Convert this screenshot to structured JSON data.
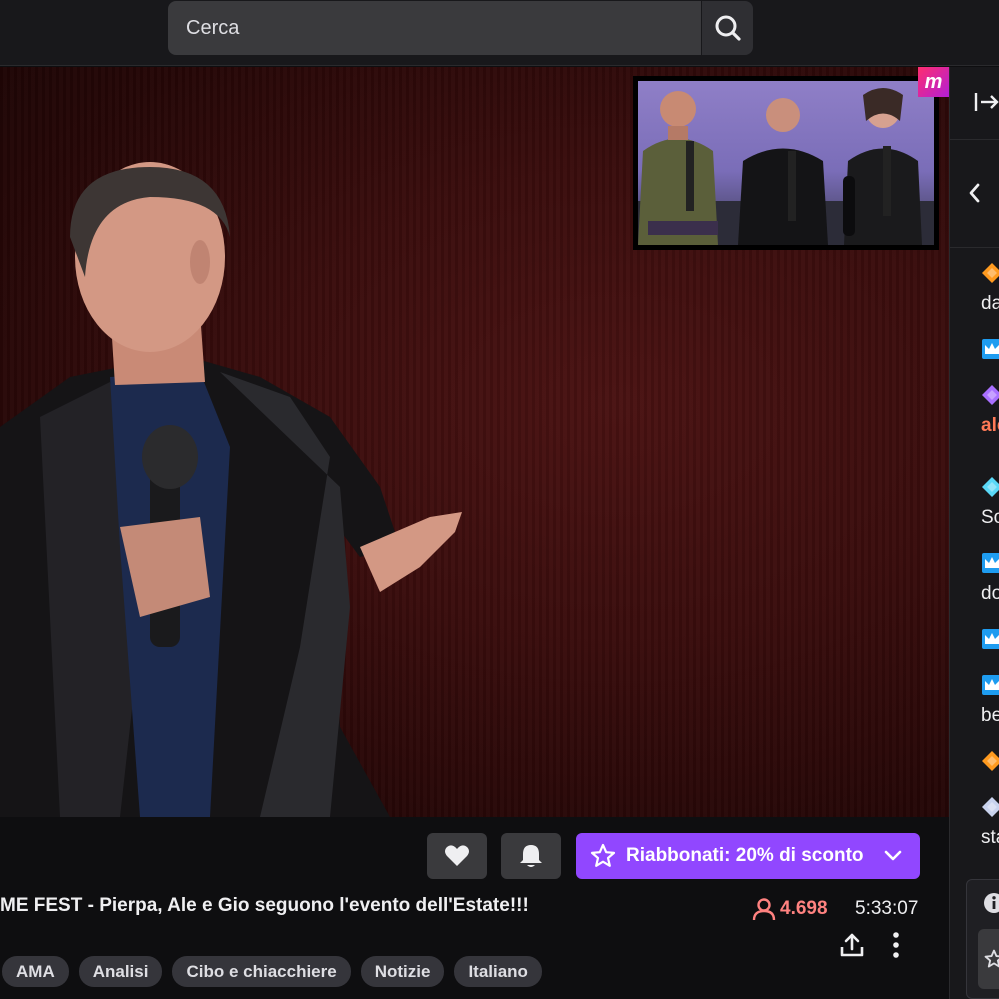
{
  "search": {
    "placeholder": "Cerca"
  },
  "overlay": {
    "logo_letter": "m"
  },
  "stream": {
    "title": "ME FEST - Pierpa, Ale e Gio seguono l'evento dell'Estate!!!",
    "viewers": "4.698",
    "uptime": "5:33:07",
    "subscribe_label": "Riabbonati: 20% di sconto",
    "tags": [
      "AMA",
      "Analisi",
      "Cibo e chiacchiere",
      "Notizie",
      "Italiano"
    ]
  },
  "chat": {
    "messages": [
      {
        "badge": "orange-gem-icon",
        "color": "#ff9a1f",
        "text": "da",
        "text_color": "#efeff1"
      },
      {
        "badge": "crown-icon",
        "color": "#1e9cf0",
        "text": "",
        "text_color": "#efeff1"
      },
      {
        "badge": "purple-gem-icon",
        "color": "#a970ff",
        "text": "ale",
        "text_color": "#ff7a57"
      },
      {
        "badge": "cyan-gem-icon",
        "color": "#5ad8f7",
        "text": "So",
        "text_color": "#efeff1"
      },
      {
        "badge": "crown-icon",
        "color": "#1e9cf0",
        "text": "do",
        "text_color": "#efeff1"
      },
      {
        "badge": "crown-icon",
        "color": "#1e9cf0",
        "text": "",
        "text_color": "#efeff1"
      },
      {
        "badge": "crown-icon",
        "color": "#1e9cf0",
        "text": "be",
        "text_color": "#efeff1"
      },
      {
        "badge": "orange-gem-icon",
        "color": "#ff9a1f",
        "text": "",
        "text_color": "#efeff1"
      },
      {
        "badge": "silver-gem-icon",
        "color": "#c9d3ee",
        "text": "sta",
        "text_color": "#efeff1"
      }
    ]
  },
  "colors": {
    "accent": "#9147ff",
    "live_red": "#ff8280"
  }
}
